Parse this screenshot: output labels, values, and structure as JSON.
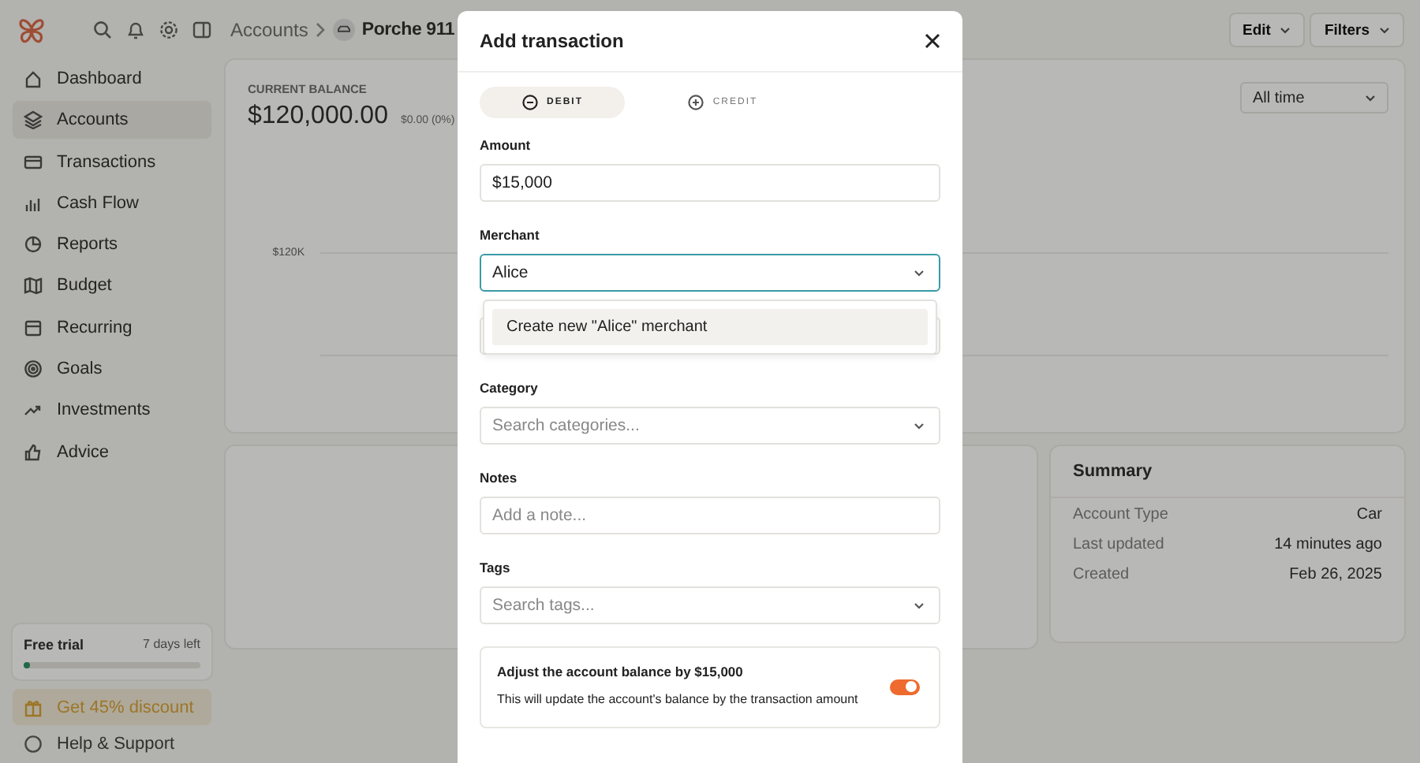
{
  "sidebar": {
    "items": [
      {
        "label": "Dashboard",
        "selected": false
      },
      {
        "label": "Accounts",
        "selected": true
      },
      {
        "label": "Transactions",
        "selected": false
      },
      {
        "label": "Cash Flow",
        "selected": false
      },
      {
        "label": "Reports",
        "selected": false
      },
      {
        "label": "Budget",
        "selected": false
      },
      {
        "label": "Recurring",
        "selected": false
      },
      {
        "label": "Goals",
        "selected": false
      },
      {
        "label": "Investments",
        "selected": false
      },
      {
        "label": "Advice",
        "selected": false
      }
    ],
    "trial": {
      "title": "Free trial",
      "remaining": "7 days left",
      "level": 0.04
    },
    "promo": "Get 45% discount",
    "help": "Help & Support"
  },
  "header": {
    "breadcrumb": [
      "Accounts",
      "Porche 911"
    ],
    "buttons": [
      "Edit",
      "Filters"
    ]
  },
  "balance_card": {
    "label": "CURRENT BALANCE",
    "amount": "$120,000.00",
    "change": "$0.00 (0%)",
    "period": "All time",
    "axis_label": "$120K"
  },
  "summary": {
    "title": "Summary",
    "rows": [
      {
        "label": "Account Type",
        "value": "Car"
      },
      {
        "label": "Last updated",
        "value": "14 minutes ago"
      },
      {
        "label": "Created",
        "value": "Feb 26, 2025"
      }
    ]
  },
  "modal": {
    "title": "Add transaction",
    "types": [
      {
        "label": "DEBIT",
        "kind": "minus",
        "selected": true
      },
      {
        "label": "CREDIT",
        "kind": "plus",
        "selected": false
      }
    ],
    "fields": [
      {
        "label": "Amount",
        "kind": "text",
        "value": "$15,000"
      },
      {
        "label": "Merchant",
        "kind": "select",
        "value": "Alice",
        "focused": true,
        "options": [
          "Create new \"Alice\" merchant"
        ]
      },
      {
        "kind": "date"
      },
      {
        "label": "Category",
        "kind": "select",
        "placeholder": "Search categories..."
      },
      {
        "label": "Notes",
        "kind": "text",
        "placeholder": "Add a note..."
      },
      {
        "label": "Tags",
        "kind": "select",
        "placeholder": "Search tags..."
      }
    ],
    "adjust": {
      "title": "Adjust the account balance by $15,000",
      "description": "This will update the account's balance by the transaction amount",
      "on": true
    }
  }
}
